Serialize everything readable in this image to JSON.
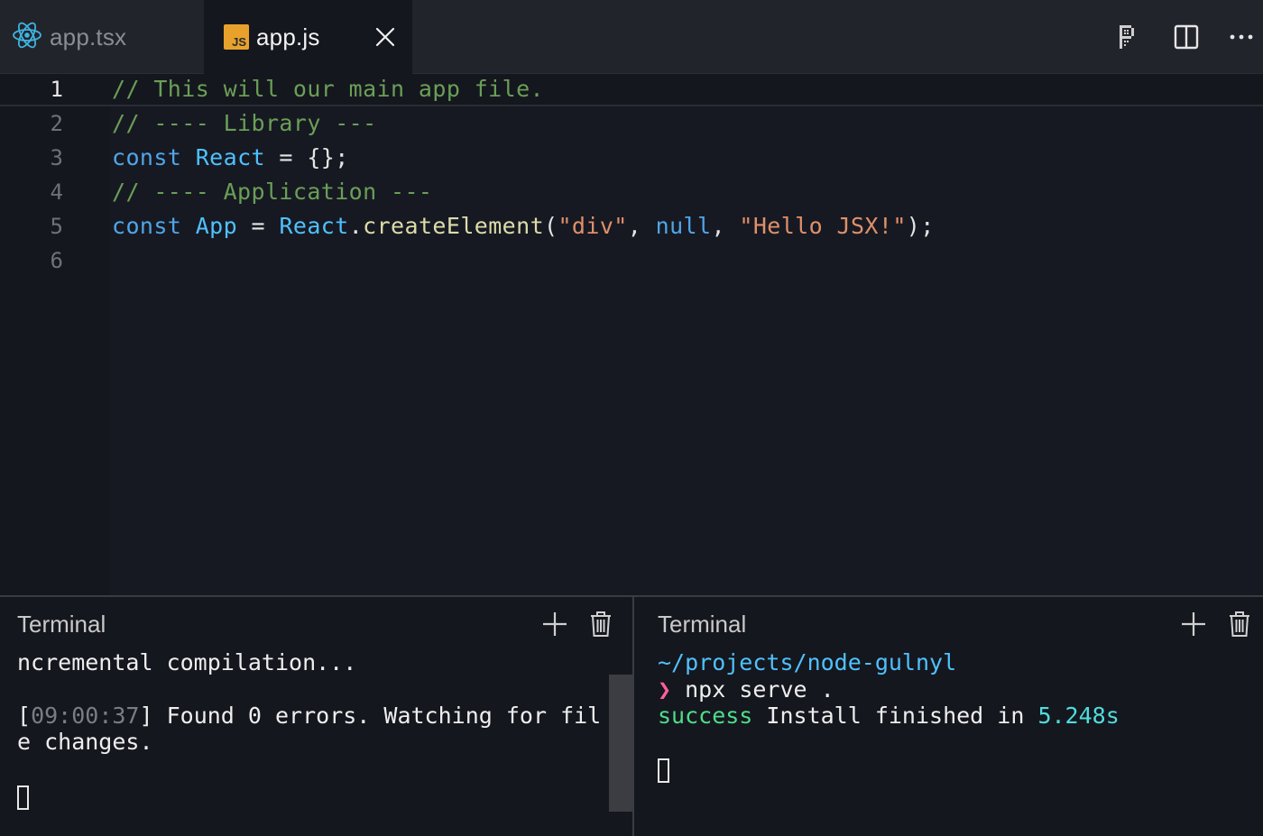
{
  "tabs": [
    {
      "label": "app.tsx",
      "icon": "react-icon",
      "active": false
    },
    {
      "label": "app.js",
      "icon": "js-file-icon",
      "badge": "JS",
      "active": true
    }
  ],
  "toolbar": {
    "icons": [
      "markdown-preview-icon",
      "split-editor-icon",
      "more-actions-icon"
    ]
  },
  "editor": {
    "active_line": 1,
    "lines": [
      {
        "number": "1",
        "tokens": [
          {
            "t": "// This will our main app file.",
            "k": "comment"
          }
        ]
      },
      {
        "number": "2",
        "tokens": [
          {
            "t": "// ---- Library ---",
            "k": "comment"
          }
        ]
      },
      {
        "number": "3",
        "tokens": [
          {
            "t": "const",
            "k": "kw"
          },
          {
            "t": " ",
            "k": "plain"
          },
          {
            "t": "React",
            "k": "var"
          },
          {
            "t": " = {};",
            "k": "plain"
          }
        ]
      },
      {
        "number": "4",
        "tokens": [
          {
            "t": "// ---- Application ---",
            "k": "comment"
          }
        ]
      },
      {
        "number": "5",
        "tokens": [
          {
            "t": "const",
            "k": "kw"
          },
          {
            "t": " ",
            "k": "plain"
          },
          {
            "t": "App",
            "k": "var"
          },
          {
            "t": " = ",
            "k": "plain"
          },
          {
            "t": "React",
            "k": "var"
          },
          {
            "t": ".",
            "k": "plain"
          },
          {
            "t": "createElement",
            "k": "fn"
          },
          {
            "t": "(",
            "k": "plain"
          },
          {
            "t": "\"div\"",
            "k": "str"
          },
          {
            "t": ", ",
            "k": "plain"
          },
          {
            "t": "null",
            "k": "null"
          },
          {
            "t": ", ",
            "k": "plain"
          },
          {
            "t": "\"Hello JSX!\"",
            "k": "str"
          },
          {
            "t": ");",
            "k": "plain"
          }
        ]
      },
      {
        "number": "6",
        "tokens": []
      }
    ]
  },
  "terminal_left": {
    "title": "Terminal",
    "line1": "ncremental compilation...",
    "line3_open": "[",
    "line3_time": "09:00:37",
    "line3_rest": "] Found 0 errors. Watching for fil",
    "line4": "e changes."
  },
  "terminal_right": {
    "title": "Terminal",
    "path": "~/projects/node-gulnyl",
    "prompt_symbol": "❯",
    "command": " npx serve .",
    "success_word": "success",
    "install_text": " Install finished in ",
    "install_time": "5.248s"
  },
  "colors": {
    "accent_react": "#3fb4e0",
    "js_badge": "#e8a22c",
    "comment": "#6a9f57",
    "keyword": "#4fa6e8",
    "string": "#e0906a",
    "success": "#4fdc8a"
  }
}
